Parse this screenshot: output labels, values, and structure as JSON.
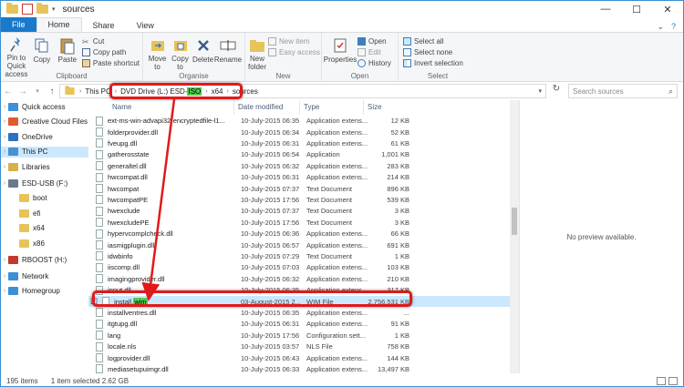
{
  "window": {
    "title": "sources",
    "controls": [
      "—",
      "☐",
      "✕"
    ]
  },
  "tabs": [
    {
      "label": "File"
    },
    {
      "label": "Home"
    },
    {
      "label": "Share"
    },
    {
      "label": "View"
    }
  ],
  "ribbon": {
    "clipboard": {
      "pin": "Pin to Quick access",
      "copy": "Copy",
      "paste": "Paste",
      "cut": "Cut",
      "copy_path": "Copy path",
      "paste_shortcut": "Paste shortcut",
      "label": "Clipboard"
    },
    "organise": {
      "move_to": "Move to",
      "copy_to": "Copy to",
      "delete": "Delete",
      "rename": "Rename",
      "label": "Organise"
    },
    "new": {
      "new_folder": "New folder",
      "new_item": "New item",
      "easy_access": "Easy access",
      "label": "New"
    },
    "open": {
      "properties": "Properties",
      "open": "Open",
      "edit": "Edit",
      "history": "History",
      "label": "Open"
    },
    "select": {
      "select_all": "Select all",
      "select_none": "Select none",
      "invert": "Invert selection",
      "label": "Select"
    }
  },
  "address": {
    "crumbs": [
      "This PC",
      "DVD Drive (L:) ESD-ISO",
      "x64",
      "sources"
    ],
    "drive_prefix": "DVD Drive (L:) ESD-",
    "drive_highlight": "ISO",
    "search_placeholder": "Search sources"
  },
  "nav": [
    {
      "label": "Quick access",
      "icon": "star-icon",
      "color": "#3c8fd8"
    },
    {
      "label": "Creative Cloud Files",
      "icon": "cloud-icon",
      "color": "#e05a2b"
    },
    {
      "label": "OneDrive",
      "icon": "onedrive-icon",
      "color": "#2b72c2"
    },
    {
      "label": "This PC",
      "icon": "computer-icon",
      "color": "#4a90d0"
    },
    {
      "label": "Libraries",
      "icon": "library-icon",
      "color": "#d8b04a"
    },
    {
      "label": "ESD-USB (F:)",
      "icon": "usb-drive-icon",
      "color": "#6a7a8a"
    },
    {
      "label": "boot",
      "icon": "folder-icon",
      "color": "#e8c35a"
    },
    {
      "label": "efi",
      "icon": "folder-icon",
      "color": "#e8c35a"
    },
    {
      "label": "x64",
      "icon": "folder-icon",
      "color": "#e8c35a"
    },
    {
      "label": "x86",
      "icon": "folder-icon",
      "color": "#e8c35a"
    },
    {
      "label": "RBOOST (H:)",
      "icon": "drive-icon",
      "color": "#c0392b"
    },
    {
      "label": "Network",
      "icon": "network-icon",
      "color": "#3c8fd8"
    },
    {
      "label": "Homegroup",
      "icon": "homegroup-icon",
      "color": "#3c8fd8"
    }
  ],
  "columns": [
    "Name",
    "Date modified",
    "Type",
    "Size"
  ],
  "files": [
    {
      "name": "ext-ms-win-advapi32-encryptedfile-l1...",
      "date": "10-July-2015 06:35",
      "type": "Application extens...",
      "size": "12 KB"
    },
    {
      "name": "folderprovider.dll",
      "date": "10-July-2015 06:34",
      "type": "Application extens...",
      "size": "52 KB"
    },
    {
      "name": "fveupg.dll",
      "date": "10-July-2015 06:31",
      "type": "Application extens...",
      "size": "61 KB"
    },
    {
      "name": "gatherosstate",
      "date": "10-July-2015 06:54",
      "type": "Application",
      "size": "1,001 KB"
    },
    {
      "name": "generaltel.dll",
      "date": "10-July-2015 06:32",
      "type": "Application extens...",
      "size": "283 KB"
    },
    {
      "name": "hwcompat.dll",
      "date": "10-July-2015 06:31",
      "type": "Application extens...",
      "size": "214 KB"
    },
    {
      "name": "hwcompat",
      "date": "10-July-2015 07:37",
      "type": "Text Document",
      "size": "896 KB"
    },
    {
      "name": "hwcompatPE",
      "date": "10-July-2015 17:56",
      "type": "Text Document",
      "size": "539 KB"
    },
    {
      "name": "hwexclude",
      "date": "10-July-2015 07:37",
      "type": "Text Document",
      "size": "3 KB"
    },
    {
      "name": "hwexcludePE",
      "date": "10-July-2015 17:56",
      "type": "Text Document",
      "size": "3 KB"
    },
    {
      "name": "hypervcomplcheck.dll",
      "date": "10-July-2015 06:36",
      "type": "Application extens...",
      "size": "66 KB"
    },
    {
      "name": "iasmigplugin.dll",
      "date": "10-July-2015 06:57",
      "type": "Application extens...",
      "size": "691 KB"
    },
    {
      "name": "idwbinfo",
      "date": "10-July-2015 07:29",
      "type": "Text Document",
      "size": "1 KB"
    },
    {
      "name": "iiscomp.dll",
      "date": "10-July-2015 07:03",
      "type": "Application extens...",
      "size": "103 KB"
    },
    {
      "name": "imagingprovider.dll",
      "date": "10-July-2015 06:32",
      "type": "Application extens...",
      "size": "210 KB"
    },
    {
      "name": "input.dll",
      "date": "10-July-2015 06:35",
      "type": "Application extens...",
      "size": "317 KB"
    },
    {
      "name": "install.wim",
      "name_prefix": "install.",
      "name_highlight": "wim",
      "date": "03-August-2015 2...",
      "type": "WIM File",
      "size": "2,756,531 KB",
      "selected": true
    },
    {
      "name": "installventres.dll",
      "date": "10-July-2015 06:35",
      "type": "Application extens...",
      "size": "..."
    },
    {
      "name": "itgtupg.dll",
      "date": "10-July-2015 06:31",
      "type": "Application extens...",
      "size": "91 KB"
    },
    {
      "name": "lang",
      "date": "10-July-2015 17:56",
      "type": "Configuration sett...",
      "size": "1 KB"
    },
    {
      "name": "locale.nls",
      "date": "10-July-2015 03:57",
      "type": "NLS File",
      "size": "758 KB"
    },
    {
      "name": "logprovider.dll",
      "date": "10-July-2015 06:43",
      "type": "Application extens...",
      "size": "144 KB"
    },
    {
      "name": "mediasetupuimgr.dll",
      "date": "10-July-2015 06:33",
      "type": "Application extens...",
      "size": "13,497 KB"
    }
  ],
  "preview": {
    "text": "No preview available."
  },
  "status": {
    "count": "195 items",
    "selected": "1 item selected  2.62 GB"
  },
  "colors": {
    "accent": "#1979ca",
    "highlight_border": "#e01a1a",
    "highlight_fill": "#4fce4f",
    "selection": "#cce8ff"
  }
}
